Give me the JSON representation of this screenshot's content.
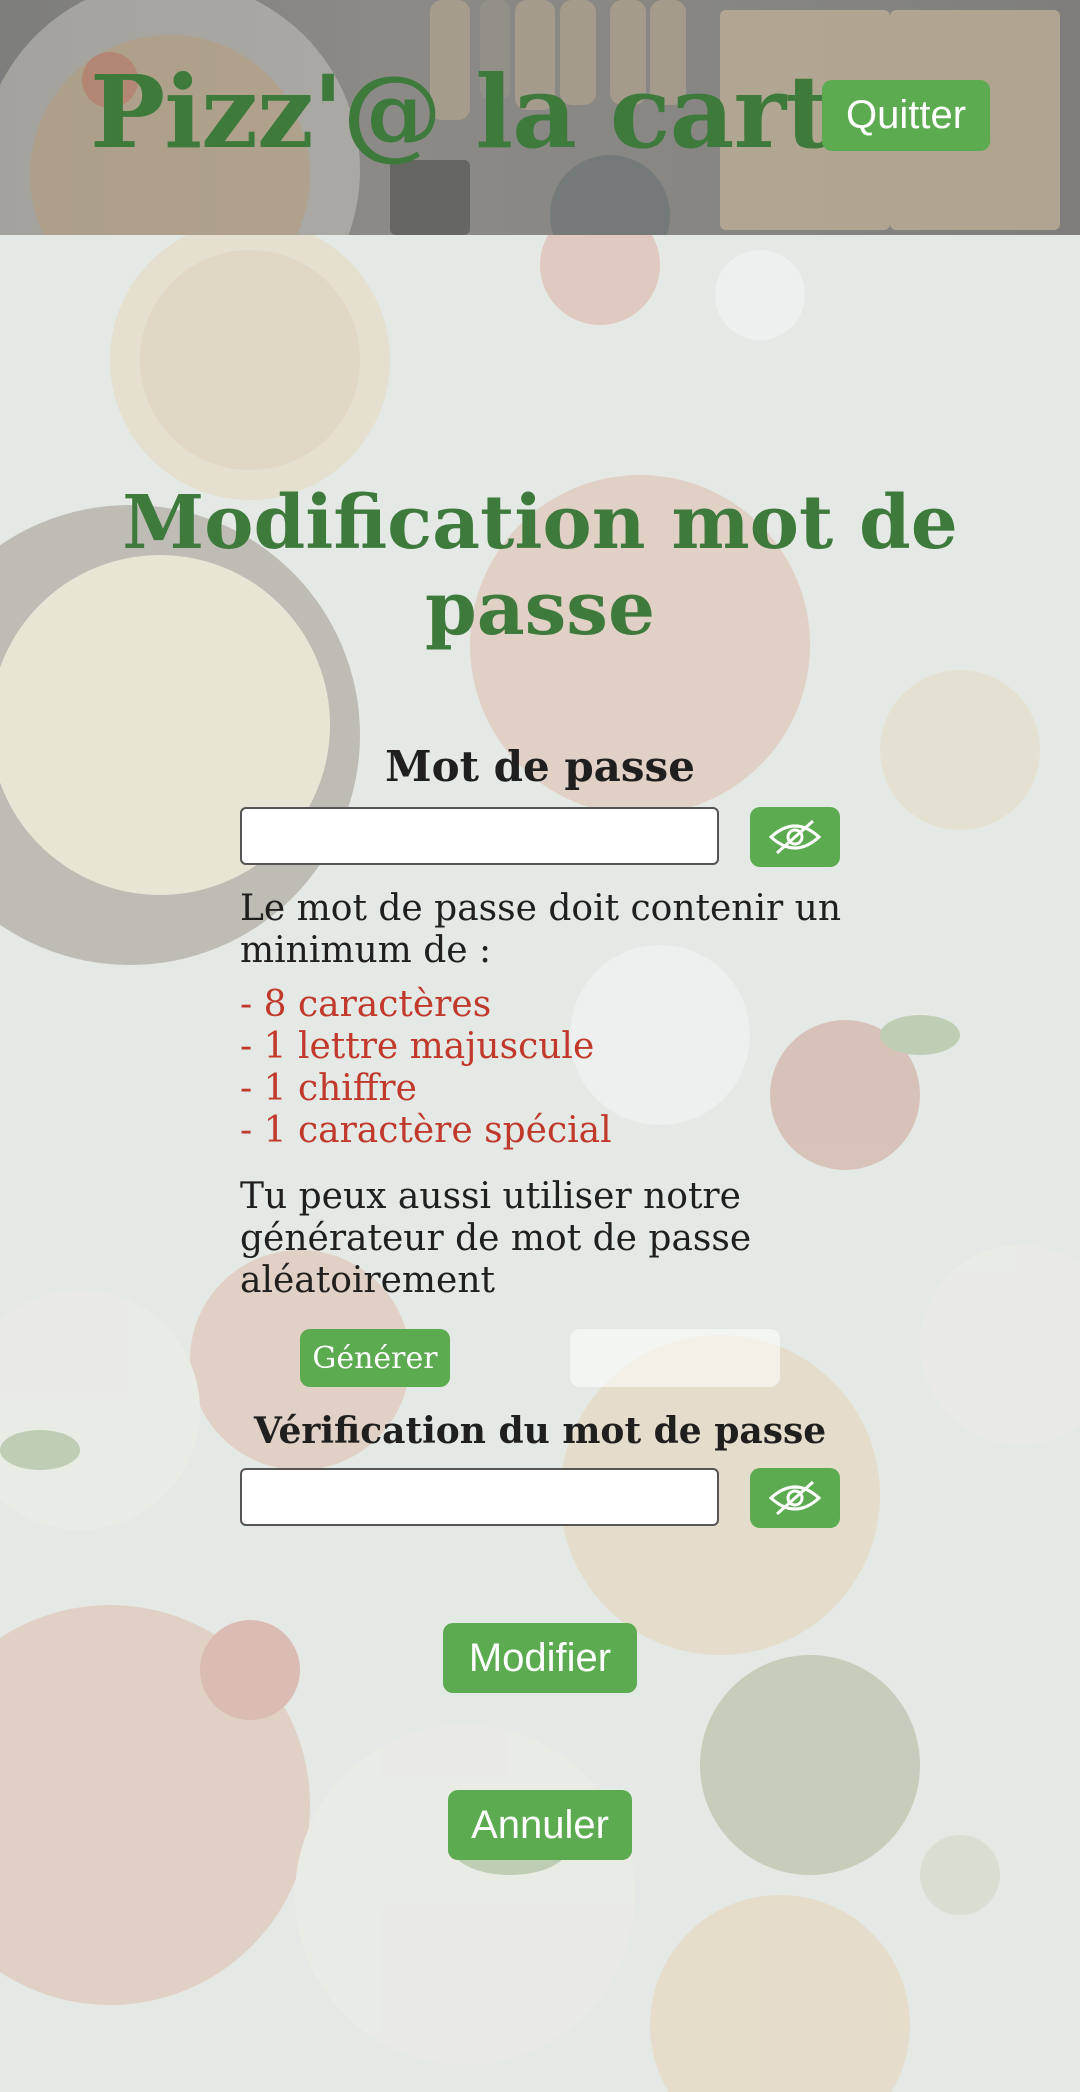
{
  "header": {
    "app_title": "Pizz'@ la carte",
    "quit_label": "Quitter"
  },
  "main": {
    "page_title": "Modification mot de passe",
    "password_label": "Mot de passe",
    "password_value": "",
    "rules_intro": "Le mot de passe doit contenir un minimum de :",
    "rules": [
      "- 8 caractères",
      "- 1 lettre majuscule",
      "- 1 chiffre",
      "- 1 caractère spécial"
    ],
    "generator_text": "Tu peux aussi utiliser notre générateur de mot de passe aléatoirement",
    "generate_label": "Générer",
    "generated_value": "",
    "verify_label": "Vérification du mot de passe",
    "verify_value": "",
    "modify_label": "Modifier",
    "cancel_label": "Annuler"
  },
  "icons": {
    "toggle_visibility": "eye-slash-icon"
  },
  "colors": {
    "accent_green": "#5cab51",
    "title_green": "#3e7a3c",
    "rule_red": "#c0392b",
    "header_gray": "#858480",
    "background": "#e4e9e5"
  }
}
